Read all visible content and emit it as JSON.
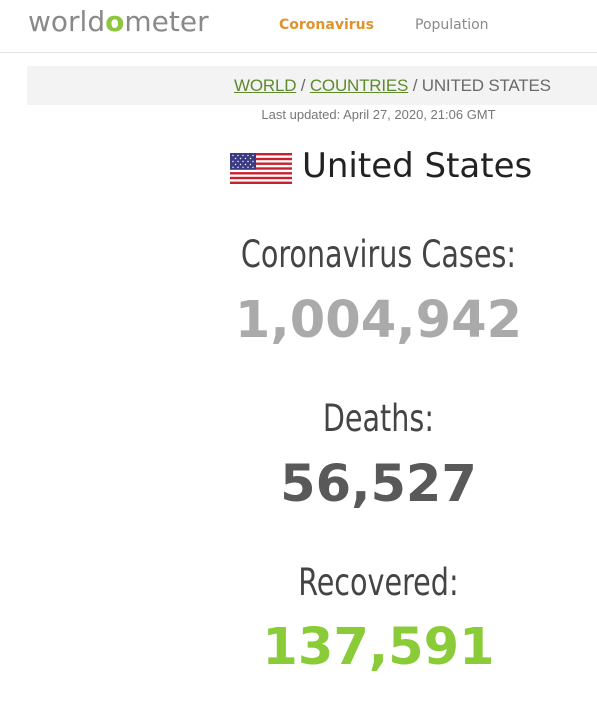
{
  "header": {
    "logo_prefix": "worldo",
    "logo_dot": "o",
    "logo_suffix": "meter",
    "nav": [
      {
        "label": "Coronavirus",
        "active": true
      },
      {
        "label": "Population",
        "active": false
      }
    ]
  },
  "breadcrumb": {
    "world": "WORLD",
    "sep1": " / ",
    "countries": "COUNTRIES",
    "sep2": " / ",
    "current": "UNITED STATES"
  },
  "last_updated": "Last updated: April 27, 2020, 21:06 GMT",
  "country": {
    "name": "United States",
    "flag_icon": "us-flag-icon"
  },
  "stats": {
    "cases_label": "Coronavirus Cases:",
    "cases_value": "1,004,942",
    "deaths_label": "Deaths:",
    "deaths_value": "56,527",
    "recovered_label": "Recovered:",
    "recovered_value": "137,591"
  },
  "colors": {
    "brand_green": "#8dc63f",
    "nav_active": "#e0932a",
    "link_green": "#5e8a2c",
    "cases": "#aaaaaa",
    "deaths": "#595959",
    "recovered": "#8acb38"
  }
}
